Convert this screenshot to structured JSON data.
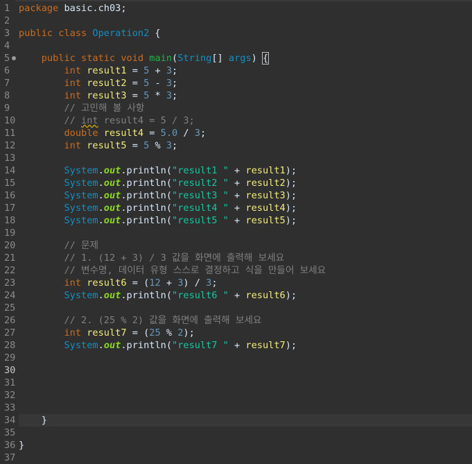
{
  "editor": {
    "lines": [
      {
        "n": "1",
        "tokens": [
          {
            "c": "kw",
            "t": "package"
          },
          {
            "c": "pl",
            "t": " basic.ch03;"
          }
        ]
      },
      {
        "n": "2",
        "tokens": []
      },
      {
        "n": "3",
        "tokens": [
          {
            "c": "kw",
            "t": "public"
          },
          {
            "c": "pl",
            "t": " "
          },
          {
            "c": "kw",
            "t": "class"
          },
          {
            "c": "pl",
            "t": " "
          },
          {
            "c": "ty",
            "t": "Operation2"
          },
          {
            "c": "pl",
            "t": " {"
          }
        ]
      },
      {
        "n": "4",
        "tokens": []
      },
      {
        "n": "5",
        "fold": true,
        "tokens": [
          {
            "c": "pl",
            "t": "    "
          },
          {
            "c": "kw",
            "t": "public"
          },
          {
            "c": "pl",
            "t": " "
          },
          {
            "c": "kw",
            "t": "static"
          },
          {
            "c": "pl",
            "t": " "
          },
          {
            "c": "kw",
            "t": "void"
          },
          {
            "c": "pl",
            "t": " "
          },
          {
            "c": "fn",
            "t": "main"
          },
          {
            "c": "pl",
            "t": "("
          },
          {
            "c": "ty",
            "t": "String"
          },
          {
            "c": "pl",
            "t": "[] "
          },
          {
            "c": "ty",
            "t": "args"
          },
          {
            "c": "pl",
            "t": ") "
          },
          {
            "c": "pl bracket-box",
            "t": "{"
          }
        ]
      },
      {
        "n": "6",
        "tokens": [
          {
            "c": "pl",
            "t": "        "
          },
          {
            "c": "kw",
            "t": "int"
          },
          {
            "c": "pl",
            "t": " "
          },
          {
            "c": "vr",
            "t": "result1"
          },
          {
            "c": "pl",
            "t": " = "
          },
          {
            "c": "num",
            "t": "5"
          },
          {
            "c": "pl",
            "t": " + "
          },
          {
            "c": "num",
            "t": "3"
          },
          {
            "c": "pl",
            "t": ";"
          }
        ]
      },
      {
        "n": "7",
        "tokens": [
          {
            "c": "pl",
            "t": "        "
          },
          {
            "c": "kw",
            "t": "int"
          },
          {
            "c": "pl",
            "t": " "
          },
          {
            "c": "vr",
            "t": "result2"
          },
          {
            "c": "pl",
            "t": " = "
          },
          {
            "c": "num",
            "t": "5"
          },
          {
            "c": "pl",
            "t": " - "
          },
          {
            "c": "num",
            "t": "3"
          },
          {
            "c": "pl",
            "t": ";"
          }
        ]
      },
      {
        "n": "8",
        "tokens": [
          {
            "c": "pl",
            "t": "        "
          },
          {
            "c": "kw",
            "t": "int"
          },
          {
            "c": "pl",
            "t": " "
          },
          {
            "c": "vr",
            "t": "result3"
          },
          {
            "c": "pl",
            "t": " = "
          },
          {
            "c": "num",
            "t": "5"
          },
          {
            "c": "pl",
            "t": " * "
          },
          {
            "c": "num",
            "t": "3"
          },
          {
            "c": "pl",
            "t": ";"
          }
        ]
      },
      {
        "n": "9",
        "tokens": [
          {
            "c": "pl",
            "t": "        "
          },
          {
            "c": "cm",
            "t": "// 고민해 볼 사항"
          }
        ]
      },
      {
        "n": "10",
        "tokens": [
          {
            "c": "pl",
            "t": "        "
          },
          {
            "c": "cm",
            "t": "// "
          },
          {
            "c": "cm squiggle",
            "t": "int"
          },
          {
            "c": "cm",
            "t": " result4 = 5 / 3;"
          }
        ]
      },
      {
        "n": "11",
        "tokens": [
          {
            "c": "pl",
            "t": "        "
          },
          {
            "c": "kw",
            "t": "double"
          },
          {
            "c": "pl",
            "t": " "
          },
          {
            "c": "vr",
            "t": "result4"
          },
          {
            "c": "pl",
            "t": " = "
          },
          {
            "c": "num",
            "t": "5.0"
          },
          {
            "c": "pl",
            "t": " / "
          },
          {
            "c": "num",
            "t": "3"
          },
          {
            "c": "pl",
            "t": ";"
          }
        ]
      },
      {
        "n": "12",
        "tokens": [
          {
            "c": "pl",
            "t": "        "
          },
          {
            "c": "kw",
            "t": "int"
          },
          {
            "c": "pl",
            "t": " "
          },
          {
            "c": "vr",
            "t": "result5"
          },
          {
            "c": "pl",
            "t": " = "
          },
          {
            "c": "num",
            "t": "5"
          },
          {
            "c": "pl",
            "t": " % "
          },
          {
            "c": "num",
            "t": "3"
          },
          {
            "c": "pl",
            "t": ";"
          }
        ]
      },
      {
        "n": "13",
        "tokens": []
      },
      {
        "n": "14",
        "tokens": [
          {
            "c": "pl",
            "t": "        "
          },
          {
            "c": "sys",
            "t": "System"
          },
          {
            "c": "pl",
            "t": "."
          },
          {
            "c": "out",
            "t": "out"
          },
          {
            "c": "pl",
            "t": ".println("
          },
          {
            "c": "str",
            "t": "\"result1 \""
          },
          {
            "c": "pl",
            "t": " + "
          },
          {
            "c": "vr",
            "t": "result1"
          },
          {
            "c": "pl",
            "t": ");"
          }
        ]
      },
      {
        "n": "15",
        "tokens": [
          {
            "c": "pl",
            "t": "        "
          },
          {
            "c": "sys",
            "t": "System"
          },
          {
            "c": "pl",
            "t": "."
          },
          {
            "c": "out",
            "t": "out"
          },
          {
            "c": "pl",
            "t": ".println("
          },
          {
            "c": "str",
            "t": "\"result2 \""
          },
          {
            "c": "pl",
            "t": " + "
          },
          {
            "c": "vr",
            "t": "result2"
          },
          {
            "c": "pl",
            "t": ");"
          }
        ]
      },
      {
        "n": "16",
        "tokens": [
          {
            "c": "pl",
            "t": "        "
          },
          {
            "c": "sys",
            "t": "System"
          },
          {
            "c": "pl",
            "t": "."
          },
          {
            "c": "out",
            "t": "out"
          },
          {
            "c": "pl",
            "t": ".println("
          },
          {
            "c": "str",
            "t": "\"result3 \""
          },
          {
            "c": "pl",
            "t": " + "
          },
          {
            "c": "vr",
            "t": "result3"
          },
          {
            "c": "pl",
            "t": ");"
          }
        ]
      },
      {
        "n": "17",
        "tokens": [
          {
            "c": "pl",
            "t": "        "
          },
          {
            "c": "sys",
            "t": "System"
          },
          {
            "c": "pl",
            "t": "."
          },
          {
            "c": "out",
            "t": "out"
          },
          {
            "c": "pl",
            "t": ".println("
          },
          {
            "c": "str",
            "t": "\"result4 \""
          },
          {
            "c": "pl",
            "t": " + "
          },
          {
            "c": "vr",
            "t": "result4"
          },
          {
            "c": "pl",
            "t": ");"
          }
        ]
      },
      {
        "n": "18",
        "tokens": [
          {
            "c": "pl",
            "t": "        "
          },
          {
            "c": "sys",
            "t": "System"
          },
          {
            "c": "pl",
            "t": "."
          },
          {
            "c": "out",
            "t": "out"
          },
          {
            "c": "pl",
            "t": ".println("
          },
          {
            "c": "str",
            "t": "\"result5 \""
          },
          {
            "c": "pl",
            "t": " + "
          },
          {
            "c": "vr",
            "t": "result5"
          },
          {
            "c": "pl",
            "t": ");"
          }
        ]
      },
      {
        "n": "19",
        "tokens": []
      },
      {
        "n": "20",
        "tokens": [
          {
            "c": "pl",
            "t": "        "
          },
          {
            "c": "cm",
            "t": "// 문제"
          }
        ]
      },
      {
        "n": "21",
        "tokens": [
          {
            "c": "pl",
            "t": "        "
          },
          {
            "c": "cm",
            "t": "// 1. (12 + 3) / 3 값을 화면에 출력해 보세요"
          }
        ]
      },
      {
        "n": "22",
        "tokens": [
          {
            "c": "pl",
            "t": "        "
          },
          {
            "c": "cm",
            "t": "// 변수명, 데이터 유형 스스로 결정하고 식을 만들어 보세요"
          }
        ]
      },
      {
        "n": "23",
        "tokens": [
          {
            "c": "pl",
            "t": "        "
          },
          {
            "c": "kw",
            "t": "int"
          },
          {
            "c": "pl",
            "t": " "
          },
          {
            "c": "vr",
            "t": "result6"
          },
          {
            "c": "pl",
            "t": " = ("
          },
          {
            "c": "num",
            "t": "12"
          },
          {
            "c": "pl",
            "t": " + "
          },
          {
            "c": "num",
            "t": "3"
          },
          {
            "c": "pl",
            "t": ") / "
          },
          {
            "c": "num",
            "t": "3"
          },
          {
            "c": "pl",
            "t": ";"
          }
        ]
      },
      {
        "n": "24",
        "tokens": [
          {
            "c": "pl",
            "t": "        "
          },
          {
            "c": "sys",
            "t": "System"
          },
          {
            "c": "pl",
            "t": "."
          },
          {
            "c": "out",
            "t": "out"
          },
          {
            "c": "pl",
            "t": ".println("
          },
          {
            "c": "str",
            "t": "\"result6 \""
          },
          {
            "c": "pl",
            "t": " + "
          },
          {
            "c": "vr",
            "t": "result6"
          },
          {
            "c": "pl",
            "t": ");"
          }
        ]
      },
      {
        "n": "25",
        "tokens": []
      },
      {
        "n": "26",
        "tokens": [
          {
            "c": "pl",
            "t": "        "
          },
          {
            "c": "cm",
            "t": "// 2. (25 % 2) 값을 화면에 출력해 보세요"
          }
        ]
      },
      {
        "n": "27",
        "tokens": [
          {
            "c": "pl",
            "t": "        "
          },
          {
            "c": "kw",
            "t": "int"
          },
          {
            "c": "pl",
            "t": " "
          },
          {
            "c": "vr",
            "t": "result7"
          },
          {
            "c": "pl",
            "t": " = ("
          },
          {
            "c": "num",
            "t": "25"
          },
          {
            "c": "pl",
            "t": " % "
          },
          {
            "c": "num",
            "t": "2"
          },
          {
            "c": "pl",
            "t": ");"
          }
        ]
      },
      {
        "n": "28",
        "tokens": [
          {
            "c": "pl",
            "t": "        "
          },
          {
            "c": "sys",
            "t": "System"
          },
          {
            "c": "pl",
            "t": "."
          },
          {
            "c": "out",
            "t": "out"
          },
          {
            "c": "pl",
            "t": ".println("
          },
          {
            "c": "str",
            "t": "\"result7 \""
          },
          {
            "c": "pl",
            "t": " + "
          },
          {
            "c": "vr",
            "t": "result7"
          },
          {
            "c": "pl",
            "t": ");"
          }
        ]
      },
      {
        "n": "29",
        "tokens": []
      },
      {
        "n": "30",
        "current": true,
        "tokens": []
      },
      {
        "n": "31",
        "tokens": []
      },
      {
        "n": "32",
        "tokens": []
      },
      {
        "n": "33",
        "tokens": []
      },
      {
        "n": "34",
        "highlight": true,
        "tokens": [
          {
            "c": "pl",
            "t": "    }"
          }
        ]
      },
      {
        "n": "35",
        "tokens": []
      },
      {
        "n": "36",
        "tokens": [
          {
            "c": "pl",
            "t": "}"
          }
        ]
      },
      {
        "n": "37",
        "tokens": []
      }
    ]
  }
}
